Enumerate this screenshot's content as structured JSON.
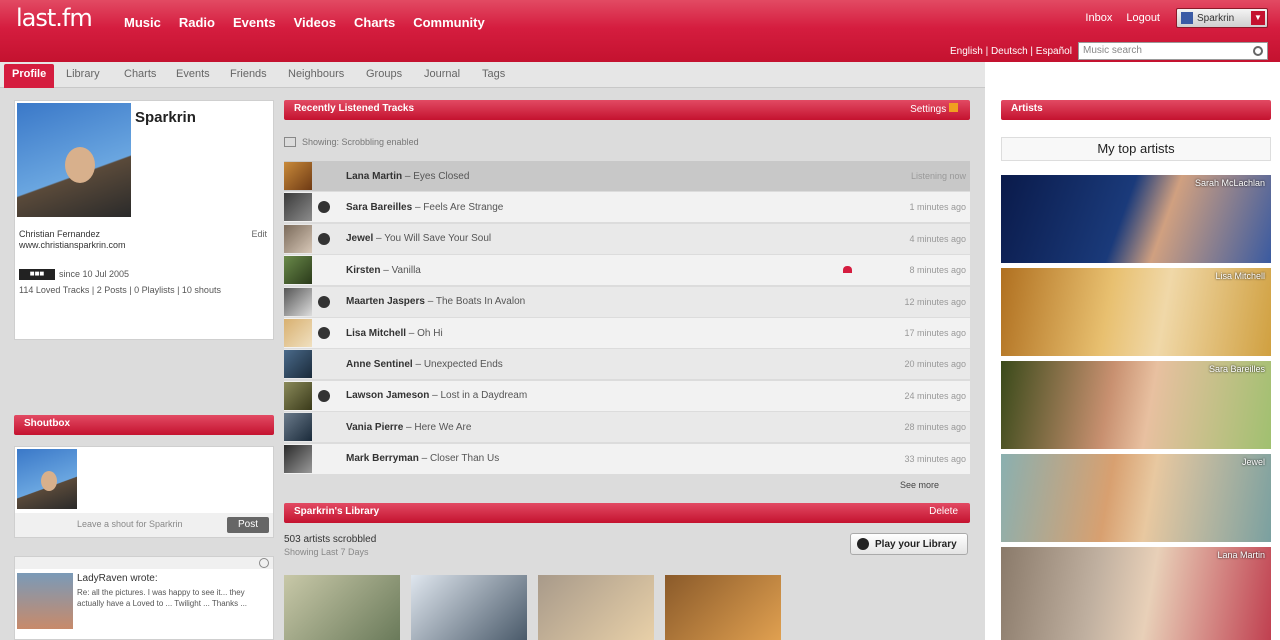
{
  "header": {
    "logo": "last.fm",
    "nav": [
      "Music",
      "Radio",
      "Events",
      "Videos",
      "Charts",
      "Community"
    ],
    "toplinks": [
      "Inbox",
      "Logout"
    ],
    "lang_button": "Sparkrin",
    "lang_line": "English  |  Deutsch  |  Español",
    "search_placeholder": "Music search"
  },
  "tabs": [
    "Profile",
    "Library",
    "Charts",
    "Events",
    "Friends",
    "Neighbours",
    "Groups",
    "Journal",
    "Tags"
  ],
  "profile": {
    "username": "Sparkrin",
    "realname": "Christian Fernandez",
    "website": "www.christiansparkrin.com",
    "edit": "Edit",
    "since": "since 10 Jul 2005",
    "stats": "114 Loved Tracks | 2 Posts | 0 Playlists | 10 shouts"
  },
  "shoutbox": {
    "title": "Shoutbox",
    "leave": "Leave a shout for Sparkrin",
    "post": "Post",
    "commenter": "LadyRaven wrote:",
    "comment": "Re: all the pictures. I was happy to see it... they actually have a Loved to ... Twilight ... Thanks ..."
  },
  "recent": {
    "title": "Recently Listened Tracks",
    "settings": "Settings",
    "showing": "Showing: Scrobbling enabled",
    "see_more": "See more",
    "tracks": [
      {
        "artist": "Lana Martin",
        "title": "Eyes Closed",
        "time": "Listening now",
        "play": false,
        "now": true,
        "loved": false,
        "c1": "#c98a3a",
        "c2": "#6e3a14"
      },
      {
        "artist": "Sara Bareilles",
        "title": "Feels Are Strange",
        "time": "1 minutes ago",
        "play": true,
        "now": false,
        "loved": false,
        "c1": "#3a3a3a",
        "c2": "#8c8c8c"
      },
      {
        "artist": "Jewel",
        "title": "You Will Save Your Soul",
        "time": "4 minutes ago",
        "play": true,
        "now": false,
        "loved": false,
        "c1": "#7a6a5a",
        "c2": "#d8c8b8"
      },
      {
        "artist": "Kirsten",
        "title": "Vanilla",
        "time": "8 minutes ago",
        "play": false,
        "now": false,
        "loved": true,
        "c1": "#6a8a4a",
        "c2": "#2a3a1a"
      },
      {
        "artist": "Maarten Jaspers",
        "title": "The Boats In Avalon",
        "time": "12 minutes ago",
        "play": true,
        "now": false,
        "loved": false,
        "c1": "#555555",
        "c2": "#dddddd"
      },
      {
        "artist": "Lisa Mitchell",
        "title": "Oh Hi",
        "time": "17 minutes ago",
        "play": true,
        "now": false,
        "loved": false,
        "c1": "#d8b070",
        "c2": "#f0e0c0"
      },
      {
        "artist": "Anne Sentinel",
        "title": "Unexpected Ends",
        "time": "20 minutes ago",
        "play": false,
        "now": false,
        "loved": false,
        "c1": "#4a6a8a",
        "c2": "#1a2a3a"
      },
      {
        "artist": "Lawson Jameson",
        "title": "Lost in a Daydream",
        "time": "24 minutes ago",
        "play": true,
        "now": false,
        "loved": false,
        "c1": "#8a8a5a",
        "c2": "#3a3a1a"
      },
      {
        "artist": "Vania Pierre",
        "title": "Here We Are",
        "time": "28 minutes ago",
        "play": false,
        "now": false,
        "loved": false,
        "c1": "#6a7a8a",
        "c2": "#1a2a3a"
      },
      {
        "artist": "Mark Berryman",
        "title": "Closer Than Us",
        "time": "33 minutes ago",
        "play": false,
        "now": false,
        "loved": false,
        "c1": "#2a2a2a",
        "c2": "#9a9a9a"
      }
    ]
  },
  "library": {
    "title": "Sparkrin's Library",
    "delete": "Delete",
    "count": "503 artists scrobbled",
    "range": "Showing Last 7 Days",
    "play_button": "Play your Library"
  },
  "artists": {
    "title": "Artists",
    "heading": "My top artists",
    "captions": [
      "Sarah McLachlan",
      "Lisa Mitchell",
      "Sara Bareilles",
      "Jewel",
      "Lana Martin"
    ]
  }
}
